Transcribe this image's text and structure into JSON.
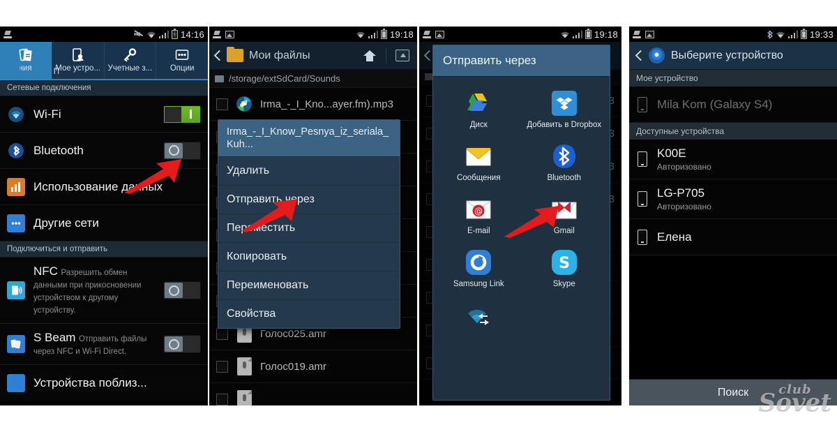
{
  "panels": {
    "settings": {
      "status": {
        "time": "14:16",
        "icons": [
          "brush-icon",
          "mute-icon",
          "wifi-icon",
          "signal-icon",
          "battery-charging-icon"
        ]
      },
      "tabs": [
        {
          "label": "чения",
          "icon": "connections-icon",
          "active": true,
          "peek": ""
        },
        {
          "label": "Мое устро...",
          "icon": "my-device-icon",
          "active": false,
          "peek": "П"
        },
        {
          "label": "Учетные з...",
          "icon": "accounts-key-icon",
          "active": false,
          "peek": ""
        },
        {
          "label": "Опции",
          "icon": "more-options-icon",
          "active": false,
          "peek": ""
        }
      ],
      "sections": [
        {
          "header": "Сетевые подключения",
          "rows": [
            {
              "title": "Wi-Fi",
              "sub": "",
              "icon": "wifi-icon",
              "toggle": "on"
            },
            {
              "title": "Bluetooth",
              "sub": "",
              "icon": "bluetooth-icon",
              "toggle": "off"
            },
            {
              "title": "Использование данных",
              "sub": "",
              "icon": "data-usage-icon",
              "toggle": "none"
            },
            {
              "title": "Другие сети",
              "sub": "",
              "icon": "other-networks-icon",
              "toggle": "none"
            }
          ]
        },
        {
          "header": "Подключиться и отправить",
          "rows": [
            {
              "title": "NFC",
              "sub": "Разрешить обмен данными при прикосновении устройством к другому устройству.",
              "icon": "nfc-icon",
              "toggle": "off"
            },
            {
              "title": "S Beam",
              "sub": "Отправить файлы через NFC и Wi-Fi Direct.",
              "icon": "s-beam-icon",
              "toggle": "off"
            },
            {
              "title": "Устройства поблиз...",
              "sub": "",
              "icon": "nearby-devices-icon",
              "toggle": "none"
            }
          ]
        }
      ]
    },
    "filemanager": {
      "status": {
        "time": "19:18",
        "icons": [
          "brush-icon",
          "picture-icon",
          "wifi-icon",
          "signal-icon",
          "battery-full-icon"
        ]
      },
      "title": "Мои файлы",
      "actions": [
        "home-icon",
        "up-folder-icon"
      ],
      "path": "/storage/extSdCard/Sounds",
      "files": [
        {
          "name": "Irma_-_I_Kno...ayer.fm).mp3",
          "icon": "music-file-icon",
          "checked": false
        },
        {
          "name": "Голос025.amr",
          "icon": "voice-file-icon",
          "checked": false
        },
        {
          "name": "Голос019.amr",
          "icon": "voice-file-icon",
          "checked": false
        }
      ],
      "context_menu": {
        "header": "Irma_-_I_Know_Pesnya_iz_seriala_Kuh...",
        "items": [
          "Удалить",
          "Отправить через",
          "Переместить",
          "Копировать",
          "Переименовать",
          "Свойства"
        ]
      }
    },
    "share": {
      "status": {
        "time": "19:18",
        "icons": [
          "brush-icon",
          "picture-icon",
          "wifi-icon",
          "signal-icon",
          "battery-full-icon"
        ]
      },
      "dialog_title": "Отправить через",
      "apps": [
        {
          "label": "Диск",
          "icon": "google-drive-icon"
        },
        {
          "label": "Добавить в Dropbox",
          "icon": "dropbox-icon"
        },
        {
          "label": "Сообщения",
          "icon": "messages-icon"
        },
        {
          "label": "Bluetooth",
          "icon": "bluetooth-icon"
        },
        {
          "label": "E-mail",
          "icon": "email-icon"
        },
        {
          "label": "Gmail",
          "icon": "gmail-icon"
        },
        {
          "label": "Samsung Link",
          "icon": "samsung-link-icon"
        },
        {
          "label": "Skype",
          "icon": "skype-icon"
        },
        {
          "label": "",
          "icon": "wifi-direct-icon"
        }
      ]
    },
    "devicepicker": {
      "status": {
        "time": "19:33",
        "icons": [
          "brush-icon",
          "picture-icon",
          "bluetooth-icon",
          "wifi-icon",
          "signal-icon",
          "battery-full-icon"
        ]
      },
      "title": "Выберите устройство",
      "sections": [
        {
          "header": "Мое устройство",
          "devices": [
            {
              "name": "Mila Kom (Galaxy S4)",
              "sub": "",
              "dim": true
            }
          ]
        },
        {
          "header": "Доступные устройства",
          "devices": [
            {
              "name": "K00E",
              "sub": "Авторизовано",
              "dim": false
            },
            {
              "name": "LG-P705",
              "sub": "Авторизовано",
              "dim": false
            },
            {
              "name": "Елена",
              "sub": "",
              "dim": false
            }
          ]
        }
      ],
      "search_button": "Поиск"
    }
  },
  "watermark": {
    "line1": "club",
    "line2": "Sovet"
  },
  "colors": {
    "accent_blue": "#2f7fb8",
    "header_blue": "#3b6383",
    "toggle_on_green": "#6fb92d",
    "arrow_red": "#e51b1b",
    "panel_black": "#050505"
  }
}
